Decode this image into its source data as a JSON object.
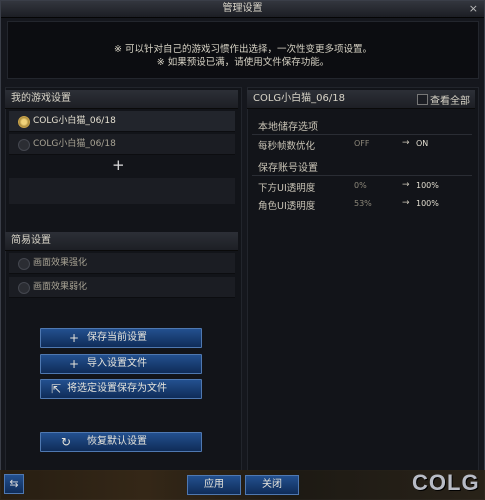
{
  "window": {
    "title": "管理设置",
    "close_symbol": "×"
  },
  "notice": {
    "line1": "※ 可以针对自己的游戏习惯作出选择，一次性变更多项设置。",
    "line2": "※ 如果预设已满，请使用文件保存功能。"
  },
  "my_settings": {
    "title": "我的游戏设置",
    "items": [
      {
        "label": "COLG小白猫_06/18",
        "selected": true
      },
      {
        "label": "COLG小白猫_06/18",
        "selected": false
      }
    ],
    "add_symbol": "+"
  },
  "simple_settings": {
    "title": "简易设置",
    "items": [
      {
        "label": "画面效果强化"
      },
      {
        "label": "画面效果弱化"
      }
    ]
  },
  "buttons": {
    "save_current": "保存当前设置",
    "import_file": "导入设置文件",
    "save_selected_file": "将选定设置保存为文件",
    "restore_default": "恢复默认设置"
  },
  "right_panel": {
    "selected_name": "COLG小白猫_06/18",
    "view_all": "查看全部",
    "local_section": "本地储存选项",
    "local_options": [
      {
        "name": "每秒帧数优化",
        "from": "OFF",
        "to": "ON"
      }
    ],
    "account_section": "保存账号设置",
    "account_options": [
      {
        "name": "下方UI透明度",
        "from": "0%",
        "to": "100%"
      },
      {
        "name": "角色UI透明度",
        "from": "53%",
        "to": "100%"
      }
    ],
    "arrow": "→"
  },
  "footer": {
    "apply": "应用",
    "close": "关闭",
    "logo": "COLG"
  }
}
